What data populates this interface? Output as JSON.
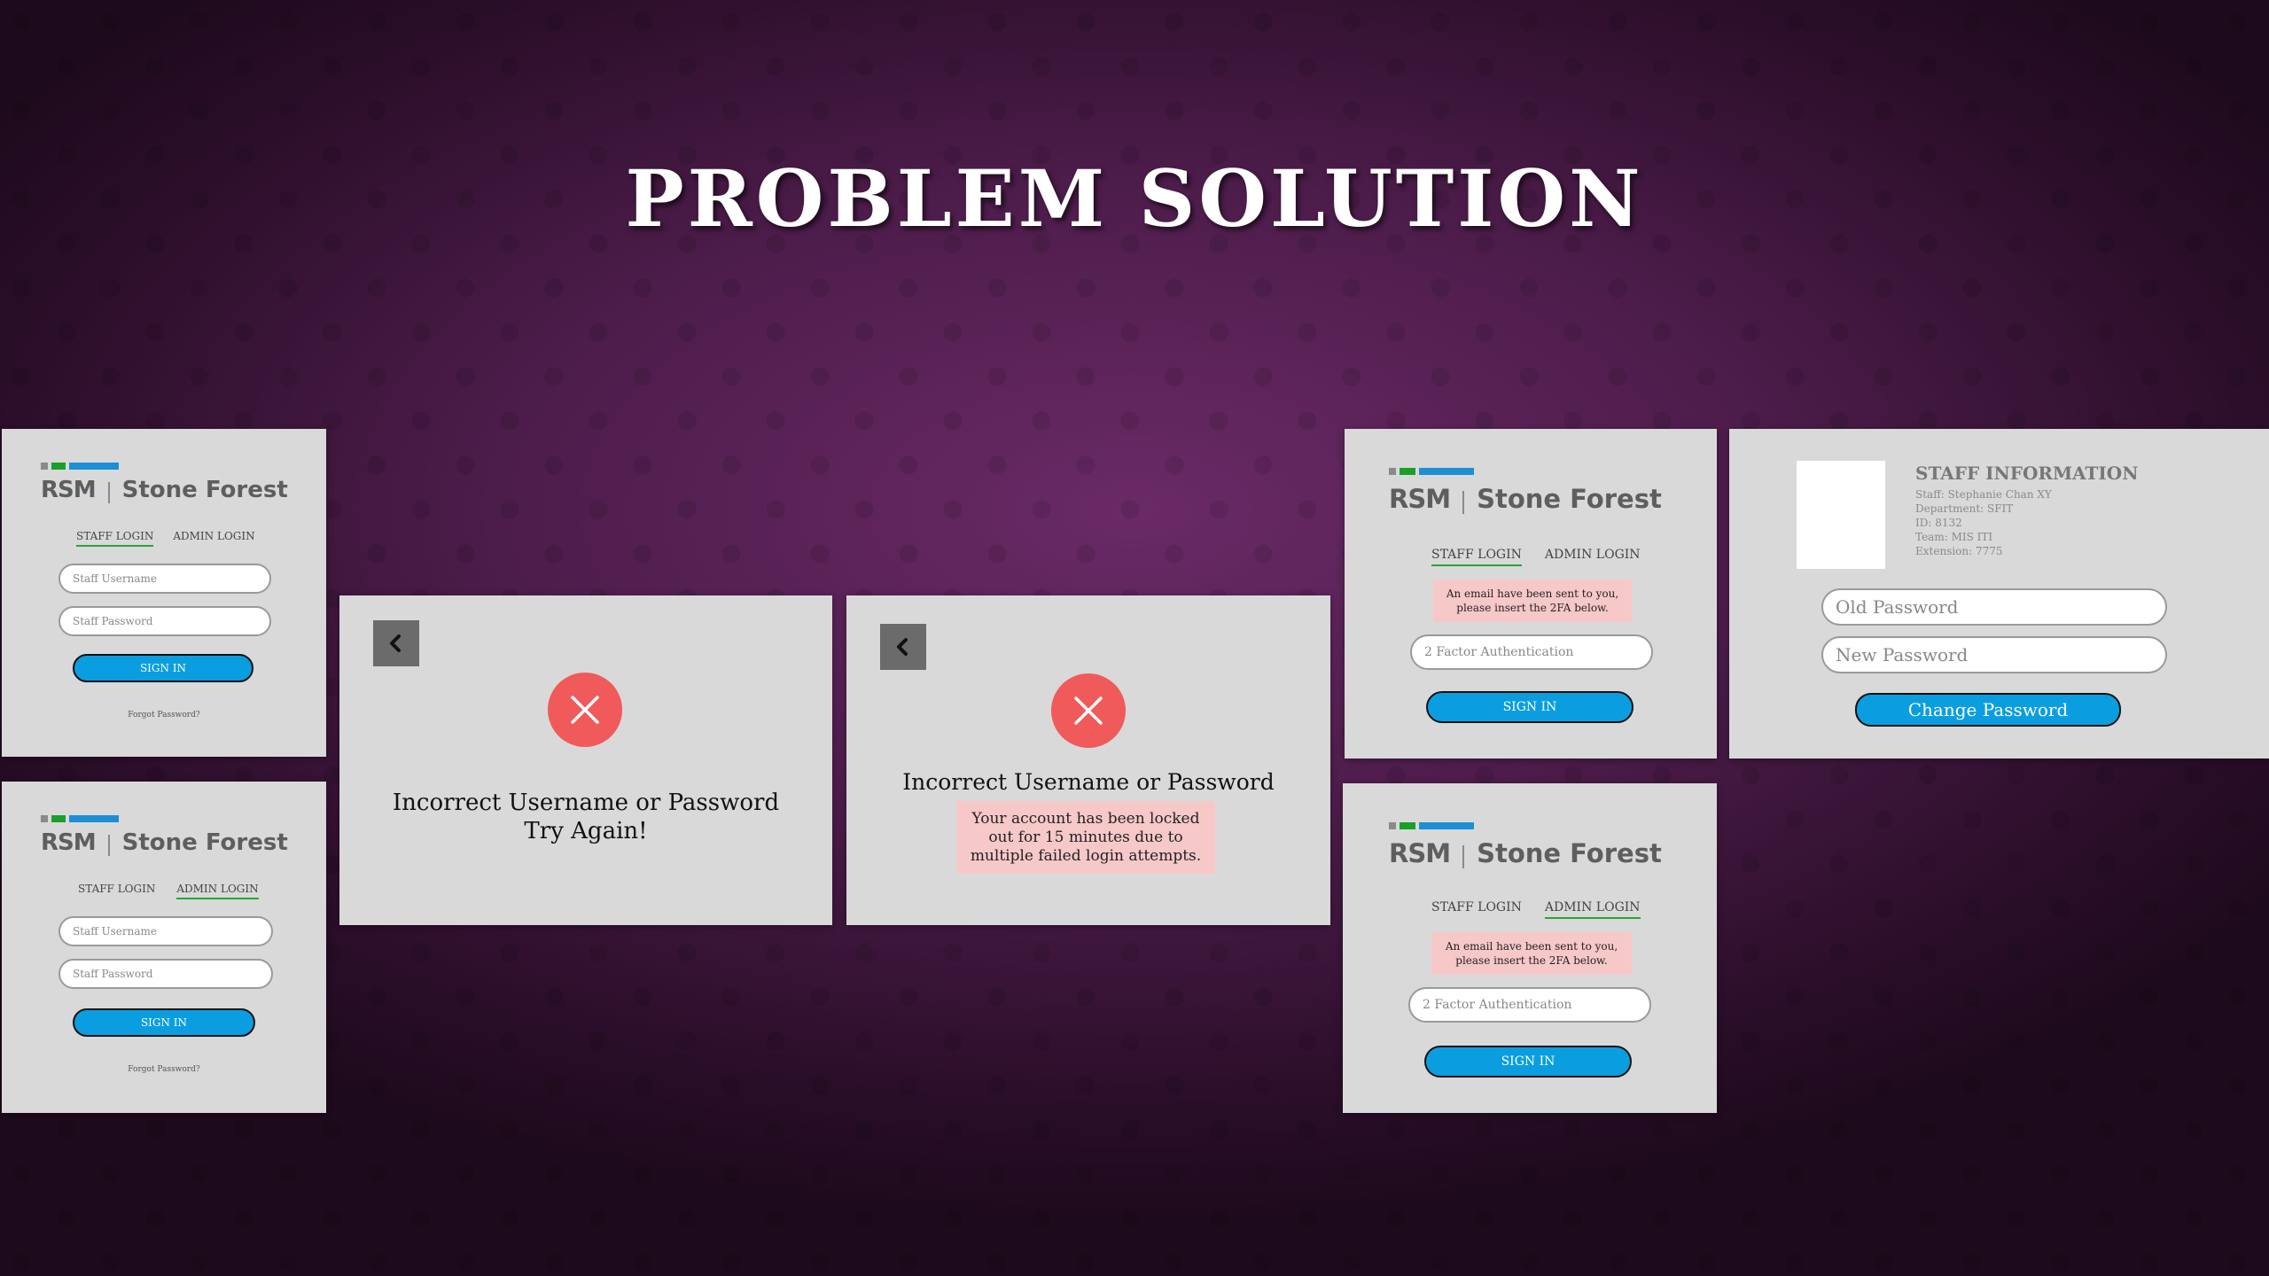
{
  "slide": {
    "title": "PROBLEM SOLUTION"
  },
  "brand": {
    "rsm": "RSM",
    "name": "Stone Forest"
  },
  "login": {
    "staff_tab": "STAFF LOGIN",
    "admin_tab": "ADMIN LOGIN",
    "username_placeholder": "Staff Username",
    "password_placeholder": "Staff Password",
    "sign_in": "SIGN IN",
    "forgot": "Forgot Password?"
  },
  "twofa": {
    "notice_line1": "An email have been sent to you,",
    "notice_line2": "please insert the 2FA below.",
    "placeholder": "2 Factor Authentication",
    "sign_in": "SIGN IN"
  },
  "error1": {
    "line1": "Incorrect Username or Password",
    "line2": "Try Again!"
  },
  "error2": {
    "heading": "Incorrect Username or Password",
    "locked_line1": "Your account has been locked",
    "locked_line2": "out for 15 minutes due to",
    "locked_line3": "multiple failed login attempts."
  },
  "staff": {
    "title": "STAFF INFORMATION",
    "name": "Staff: Stephanie Chan XY",
    "department": "Department: SFIT",
    "id": "ID: 8132",
    "team": "Team: MIS ITI",
    "extension": "Extension: 7775",
    "old_password": "Old Password",
    "new_password": "New Password",
    "change_button": "Change Password"
  },
  "icons": {
    "back": "chevron-left-icon",
    "error": "x-circle-icon"
  },
  "colors": {
    "accent_blue": "#0a9ee0",
    "error_red": "#f05a5a",
    "notice_pink": "#f7c8c8",
    "tab_green": "#2aa43a"
  }
}
